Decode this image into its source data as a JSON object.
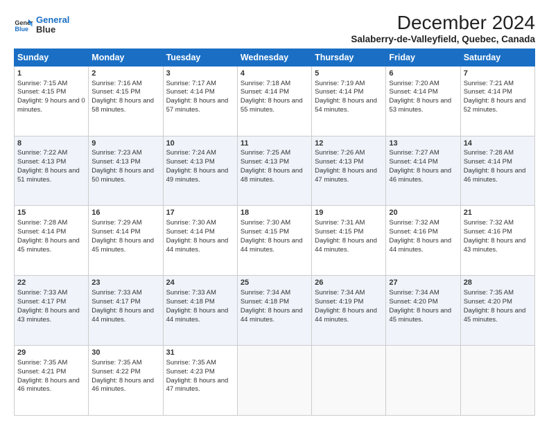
{
  "logo": {
    "line1": "General",
    "line2": "Blue"
  },
  "title": "December 2024",
  "subtitle": "Salaberry-de-Valleyfield, Quebec, Canada",
  "days_of_week": [
    "Sunday",
    "Monday",
    "Tuesday",
    "Wednesday",
    "Thursday",
    "Friday",
    "Saturday"
  ],
  "weeks": [
    [
      {
        "day": 1,
        "sunrise": "7:15 AM",
        "sunset": "4:15 PM",
        "daylight": "9 hours and 0 minutes."
      },
      {
        "day": 2,
        "sunrise": "7:16 AM",
        "sunset": "4:15 PM",
        "daylight": "8 hours and 58 minutes."
      },
      {
        "day": 3,
        "sunrise": "7:17 AM",
        "sunset": "4:14 PM",
        "daylight": "8 hours and 57 minutes."
      },
      {
        "day": 4,
        "sunrise": "7:18 AM",
        "sunset": "4:14 PM",
        "daylight": "8 hours and 55 minutes."
      },
      {
        "day": 5,
        "sunrise": "7:19 AM",
        "sunset": "4:14 PM",
        "daylight": "8 hours and 54 minutes."
      },
      {
        "day": 6,
        "sunrise": "7:20 AM",
        "sunset": "4:14 PM",
        "daylight": "8 hours and 53 minutes."
      },
      {
        "day": 7,
        "sunrise": "7:21 AM",
        "sunset": "4:14 PM",
        "daylight": "8 hours and 52 minutes."
      }
    ],
    [
      {
        "day": 8,
        "sunrise": "7:22 AM",
        "sunset": "4:13 PM",
        "daylight": "8 hours and 51 minutes."
      },
      {
        "day": 9,
        "sunrise": "7:23 AM",
        "sunset": "4:13 PM",
        "daylight": "8 hours and 50 minutes."
      },
      {
        "day": 10,
        "sunrise": "7:24 AM",
        "sunset": "4:13 PM",
        "daylight": "8 hours and 49 minutes."
      },
      {
        "day": 11,
        "sunrise": "7:25 AM",
        "sunset": "4:13 PM",
        "daylight": "8 hours and 48 minutes."
      },
      {
        "day": 12,
        "sunrise": "7:26 AM",
        "sunset": "4:13 PM",
        "daylight": "8 hours and 47 minutes."
      },
      {
        "day": 13,
        "sunrise": "7:27 AM",
        "sunset": "4:14 PM",
        "daylight": "8 hours and 46 minutes."
      },
      {
        "day": 14,
        "sunrise": "7:28 AM",
        "sunset": "4:14 PM",
        "daylight": "8 hours and 46 minutes."
      }
    ],
    [
      {
        "day": 15,
        "sunrise": "7:28 AM",
        "sunset": "4:14 PM",
        "daylight": "8 hours and 45 minutes."
      },
      {
        "day": 16,
        "sunrise": "7:29 AM",
        "sunset": "4:14 PM",
        "daylight": "8 hours and 45 minutes."
      },
      {
        "day": 17,
        "sunrise": "7:30 AM",
        "sunset": "4:14 PM",
        "daylight": "8 hours and 44 minutes."
      },
      {
        "day": 18,
        "sunrise": "7:30 AM",
        "sunset": "4:15 PM",
        "daylight": "8 hours and 44 minutes."
      },
      {
        "day": 19,
        "sunrise": "7:31 AM",
        "sunset": "4:15 PM",
        "daylight": "8 hours and 44 minutes."
      },
      {
        "day": 20,
        "sunrise": "7:32 AM",
        "sunset": "4:16 PM",
        "daylight": "8 hours and 44 minutes."
      },
      {
        "day": 21,
        "sunrise": "7:32 AM",
        "sunset": "4:16 PM",
        "daylight": "8 hours and 43 minutes."
      }
    ],
    [
      {
        "day": 22,
        "sunrise": "7:33 AM",
        "sunset": "4:17 PM",
        "daylight": "8 hours and 43 minutes."
      },
      {
        "day": 23,
        "sunrise": "7:33 AM",
        "sunset": "4:17 PM",
        "daylight": "8 hours and 44 minutes."
      },
      {
        "day": 24,
        "sunrise": "7:33 AM",
        "sunset": "4:18 PM",
        "daylight": "8 hours and 44 minutes."
      },
      {
        "day": 25,
        "sunrise": "7:34 AM",
        "sunset": "4:18 PM",
        "daylight": "8 hours and 44 minutes."
      },
      {
        "day": 26,
        "sunrise": "7:34 AM",
        "sunset": "4:19 PM",
        "daylight": "8 hours and 44 minutes."
      },
      {
        "day": 27,
        "sunrise": "7:34 AM",
        "sunset": "4:20 PM",
        "daylight": "8 hours and 45 minutes."
      },
      {
        "day": 28,
        "sunrise": "7:35 AM",
        "sunset": "4:20 PM",
        "daylight": "8 hours and 45 minutes."
      }
    ],
    [
      {
        "day": 29,
        "sunrise": "7:35 AM",
        "sunset": "4:21 PM",
        "daylight": "8 hours and 46 minutes."
      },
      {
        "day": 30,
        "sunrise": "7:35 AM",
        "sunset": "4:22 PM",
        "daylight": "8 hours and 46 minutes."
      },
      {
        "day": 31,
        "sunrise": "7:35 AM",
        "sunset": "4:23 PM",
        "daylight": "8 hours and 47 minutes."
      },
      null,
      null,
      null,
      null
    ]
  ]
}
